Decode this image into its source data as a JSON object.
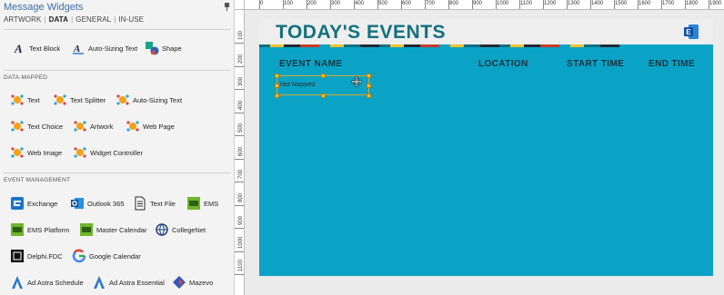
{
  "panel": {
    "title": "Message Widgets",
    "tabs": [
      "ARTWORK",
      "DATA",
      "GENERAL",
      "IN-USE"
    ],
    "active_tab": "DATA",
    "basic_items": [
      {
        "label": "Text Block",
        "icon": "text-block-icon"
      },
      {
        "label": "Auto-Sizing Text",
        "icon": "auto-sizing-text-icon"
      },
      {
        "label": "Shape",
        "icon": "shape-icon"
      }
    ],
    "data_mapped_title": "DATA-MAPPED",
    "data_mapped_items": [
      {
        "label": "Text",
        "icon": "data-text-icon"
      },
      {
        "label": "Text Splitter",
        "icon": "text-splitter-icon"
      },
      {
        "label": "Auto-Sizing Text",
        "icon": "data-auto-sizing-text-icon"
      },
      {
        "label": "Text Choice",
        "icon": "text-choice-icon"
      },
      {
        "label": "Artwork",
        "icon": "artwork-icon"
      },
      {
        "label": "Web Page",
        "icon": "web-page-icon"
      },
      {
        "label": "Web Image",
        "icon": "web-image-icon"
      },
      {
        "label": "Widget Controller",
        "icon": "widget-controller-icon"
      }
    ],
    "event_mgmt_title": "EVENT MANAGEMENT",
    "event_items": [
      {
        "label": "Exchange",
        "icon": "exchange-icon"
      },
      {
        "label": "Outlook 365",
        "icon": "outlook-icon"
      },
      {
        "label": "Text File",
        "icon": "text-file-icon"
      },
      {
        "label": "EMS",
        "icon": "ems-icon"
      },
      {
        "label": "EMS Platform",
        "icon": "ems-platform-icon"
      },
      {
        "label": "Master Calendar",
        "icon": "master-calendar-icon"
      },
      {
        "label": "CollegeNet",
        "icon": "collegenet-icon"
      },
      {
        "label": "Delphi.FDC",
        "icon": "delphi-fdc-icon"
      },
      {
        "label": "Google Calendar",
        "icon": "google-calendar-icon"
      },
      {
        "label": "Ad Astra Schedule",
        "icon": "ad-astra-schedule-icon"
      },
      {
        "label": "Ad Astra Essential",
        "icon": "ad-astra-essential-icon"
      },
      {
        "label": "Mazevo",
        "icon": "mazevo-icon"
      }
    ]
  },
  "ruler": {
    "h_labels": [
      "0",
      "100",
      "200",
      "300",
      "400",
      "500",
      "600",
      "700",
      "800",
      "900",
      "1000",
      "1100",
      "1200",
      "1300",
      "1400",
      "1500",
      "1600",
      "1700",
      "1800",
      "1900"
    ],
    "v_labels": [
      "100",
      "200",
      "300",
      "400",
      "500",
      "600",
      "700",
      "800",
      "900",
      "1000",
      "1100"
    ]
  },
  "slide": {
    "title": "TODAY'S EVENTS",
    "columns": [
      "EVENT NAME",
      "LOCATION",
      "START TIME",
      "END TIME"
    ],
    "selected_widget_text": "Not Mapped",
    "colors": {
      "background": "#0aa3c6",
      "banner": "#eeeeee",
      "title": "#12707f",
      "header_text": "#17323d"
    }
  }
}
